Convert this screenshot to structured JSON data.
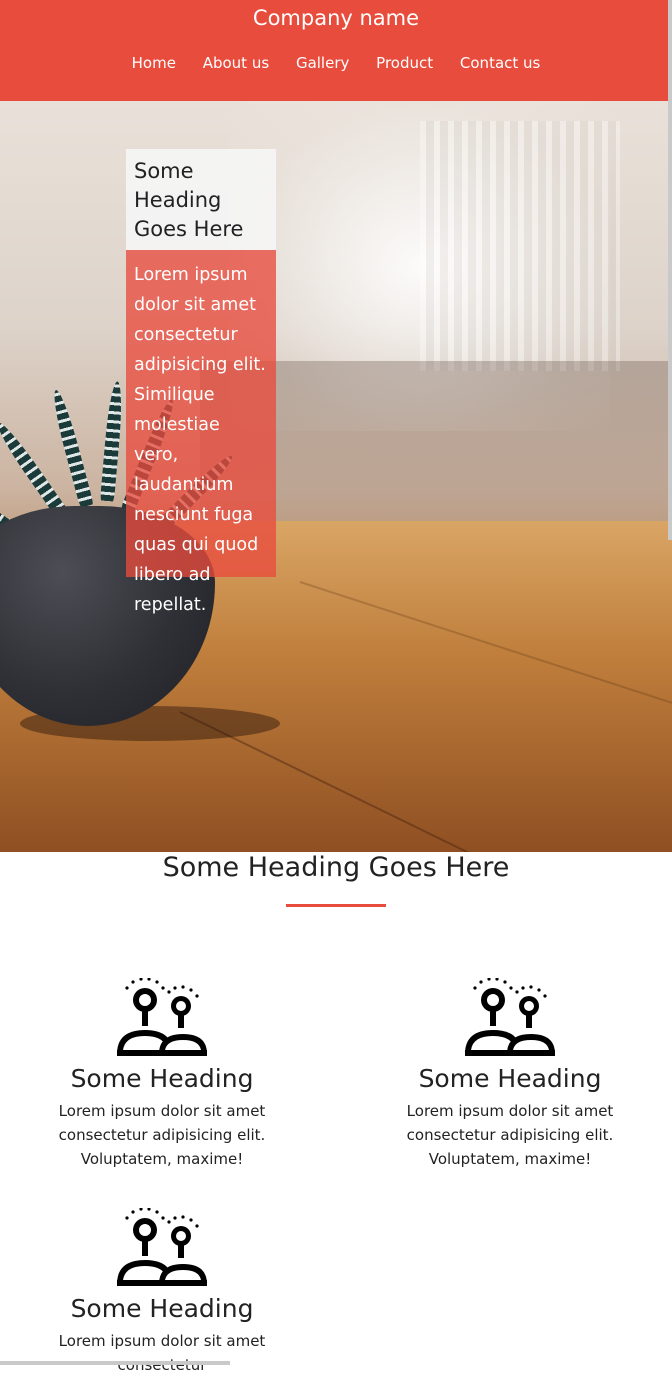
{
  "header": {
    "brand": "Company name",
    "nav": [
      "Home",
      "About us",
      "Gallery",
      "Product",
      "Contact us"
    ],
    "bg_color": "#e84c3d"
  },
  "hero": {
    "card_heading": "Some Heading Goes Here",
    "card_text": "Lorem ipsum dolor sit amet consectetur adipisicing elit. Similique molestiae vero, laudantium nesciunt fuga quas qui quod libero ad repellat."
  },
  "section": {
    "title": "Some Heading Goes Here",
    "features": [
      {
        "icon": "people-ideas-icon",
        "heading": "Some Heading",
        "text": "Lorem ipsum dolor sit amet consectetur adipisicing elit. Voluptatem, maxime!"
      },
      {
        "icon": "people-ideas-icon",
        "heading": "Some Heading",
        "text": "Lorem ipsum dolor sit amet consectetur adipisicing elit. Voluptatem, maxime!"
      },
      {
        "icon": "people-ideas-icon",
        "heading": "Some Heading",
        "text": "Lorem ipsum dolor sit amet consectetur"
      }
    ]
  },
  "colors": {
    "accent": "#e84c3d"
  }
}
